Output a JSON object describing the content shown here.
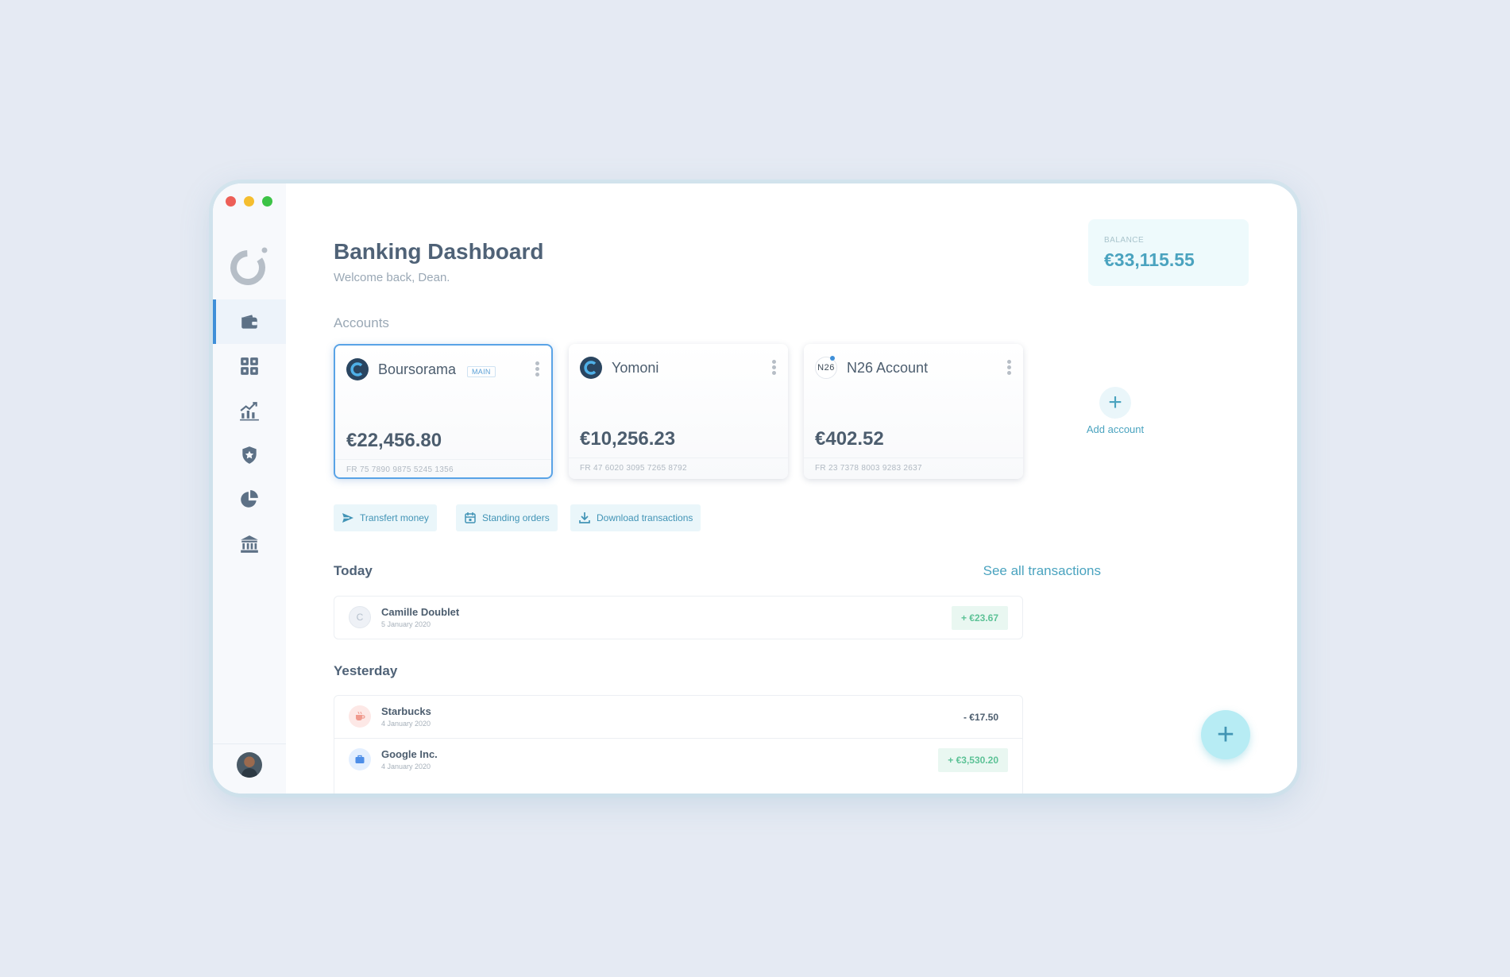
{
  "app": {
    "title": "Banking Dashboard",
    "subtitle": "Welcome back, Dean."
  },
  "balance": {
    "label": "BALANCE",
    "value": "€33,115.55"
  },
  "accounts_section": {
    "title": "Accounts",
    "items": [
      {
        "name": "Boursorama",
        "badge": "MAIN",
        "amount": "€22,456.80",
        "iban": "FR 75 7890 9875 5245 1356",
        "icon": "boursorama-logo"
      },
      {
        "name": "Yomoni",
        "badge": "",
        "amount": "€10,256.23",
        "iban": "FR 47 6020 3095 7265 8792",
        "icon": "yomoni-logo"
      },
      {
        "name": "N26 Account",
        "badge": "",
        "amount": "€402.52",
        "iban": "FR 23 7378 8003 9283 2637",
        "icon": "n26-logo",
        "icon_text": "N26"
      }
    ],
    "add_label": "Add account"
  },
  "actions": [
    {
      "label": "Transfert money",
      "icon": "send-icon"
    },
    {
      "label": "Standing orders",
      "icon": "calendar-icon"
    },
    {
      "label": "Download transactions",
      "icon": "download-icon"
    }
  ],
  "transactions": {
    "see_all": "See all transactions",
    "today": {
      "title": "Today",
      "items": [
        {
          "name": "Camille Doublet",
          "date": "5 January 2020",
          "amount": "+ €23.67",
          "direction": "positive",
          "initial": "C"
        }
      ]
    },
    "yesterday": {
      "title": "Yesterday",
      "items": [
        {
          "name": "Starbucks",
          "date": "4 January 2020",
          "amount": "- €17.50",
          "direction": "negative",
          "icon": "coffee-icon"
        },
        {
          "name": "Google Inc.",
          "date": "4 January 2020",
          "amount": "+ €3,530.20",
          "direction": "positive",
          "icon": "briefcase-icon"
        }
      ]
    }
  },
  "sidebar": {
    "items": [
      {
        "icon": "wallet-icon",
        "active": true
      },
      {
        "icon": "apps-icon",
        "active": false
      },
      {
        "icon": "chart-growth-icon",
        "active": false
      },
      {
        "icon": "shield-star-icon",
        "active": false
      },
      {
        "icon": "pie-chart-icon",
        "active": false
      },
      {
        "icon": "bank-icon",
        "active": false
      }
    ]
  },
  "colors": {
    "accent": "#4aa3bf",
    "active_border": "#59a3e6",
    "positive": "#5cc296",
    "text_dark": "#4f6277"
  }
}
